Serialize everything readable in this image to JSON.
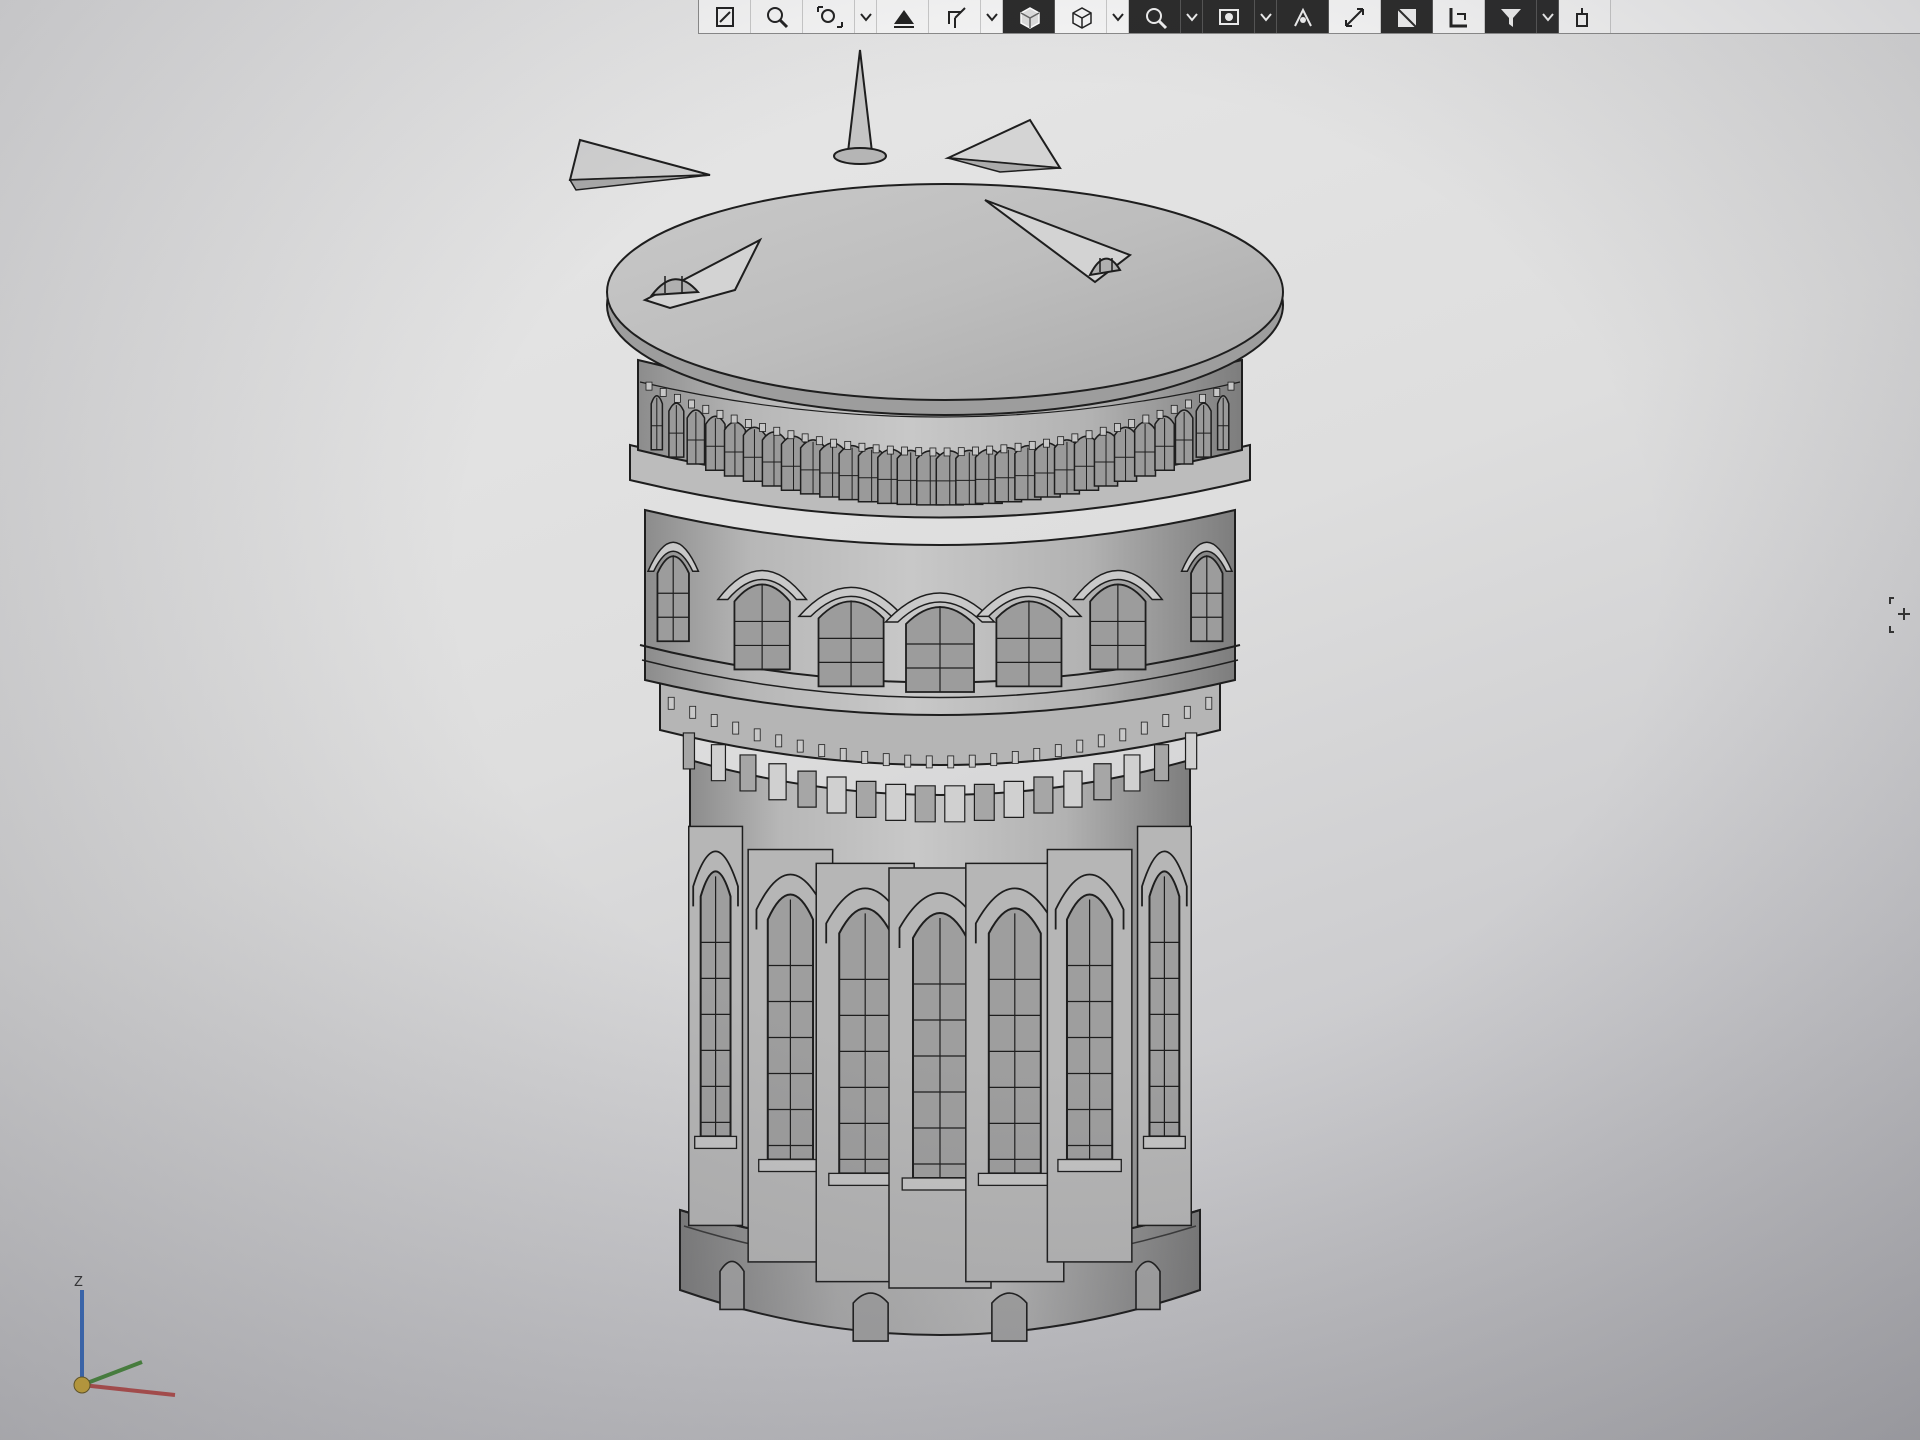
{
  "window": {
    "title": ""
  },
  "toolbar": {
    "buttons": [
      {
        "icon": "sketch-icon",
        "dark": false,
        "drop": false
      },
      {
        "icon": "zoom-area-icon",
        "dark": false,
        "drop": false
      },
      {
        "icon": "zoom-to-fit-icon",
        "dark": false,
        "drop": true
      },
      {
        "icon": "section-view-icon",
        "dark": false,
        "drop": false
      },
      {
        "icon": "view-orientation-icon",
        "dark": false,
        "drop": true
      },
      {
        "icon": "shaded-display-icon",
        "dark": true,
        "drop": false
      },
      {
        "icon": "wireframe-display-icon",
        "dark": false,
        "drop": true
      },
      {
        "icon": "hide-show-icon",
        "dark": true,
        "drop": true
      },
      {
        "icon": "edit-appearance-icon",
        "dark": true,
        "drop": true
      },
      {
        "icon": "apply-scene-icon",
        "dark": true,
        "drop": false
      },
      {
        "icon": "smart-dimension-icon",
        "dark": false,
        "drop": false
      },
      {
        "icon": "view-settings-icon",
        "dark": true,
        "drop": false
      },
      {
        "icon": "render-tools-icon",
        "dark": false,
        "drop": false
      },
      {
        "icon": "filter-icon",
        "dark": true,
        "drop": true
      },
      {
        "icon": "more-tools-icon",
        "dark": false,
        "drop": false
      }
    ]
  },
  "triad": {
    "z_label": "Z",
    "colors": {
      "x": "#c0504d",
      "y": "#4a8f3c",
      "z": "#3a6fc4"
    }
  },
  "model": {
    "name": "water tower",
    "colors": {
      "body": "#b9b9b9",
      "light": "#d6d6d6",
      "shadow": "#8a8a8a",
      "edge": "#1e1e1e"
    }
  }
}
